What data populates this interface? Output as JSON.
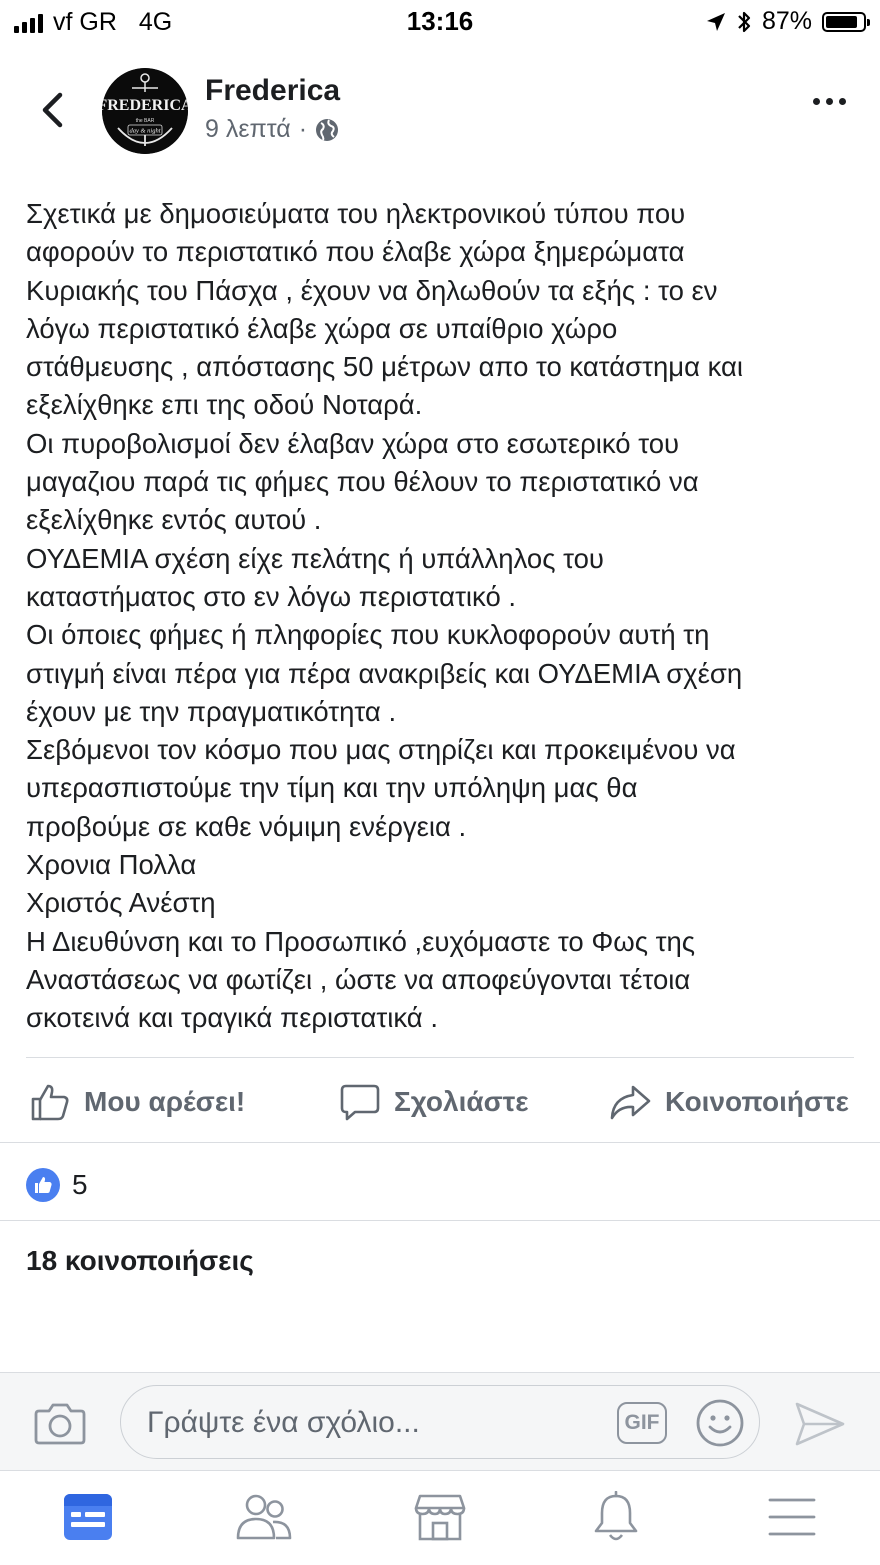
{
  "status_bar": {
    "carrier": "vf GR",
    "network": "4G",
    "time": "13:16",
    "battery": "87%",
    "battery_level": 0.87
  },
  "header": {
    "page_name": "Frederica",
    "time_ago": "9 λεπτά",
    "separator": "·",
    "avatar": {
      "text": "FREDERICA",
      "small_1": "the BAR",
      "small_2": "day & night"
    },
    "icons": {
      "back": "chevron-left-icon",
      "audience": "globe-icon",
      "more": "more-dots-icon"
    }
  },
  "post": {
    "lines": [
      "Σχετικά με δημοσιεύματα του ηλεκτρονικού τύπου που",
      "αφορούν το περιστατικό που έλαβε χώρα ξημερώματα",
      "Κυριακής του Πάσχα , έχουν να δηλωθούν τα εξής : το εν",
      "λόγω περιστατικό έλαβε χώρα σε υπαίθριο χώρο",
      "στάθμευσης , απόστασης 50 μέτρων απο το κατάστημα και",
      "εξελίχθηκε επι της οδού Νοταρά.",
      "Οι πυροβολισμοί δεν έλαβαν χώρα στο εσωτερικό του",
      "μαγαζιου παρά τις φήμες που θέλουν το περιστατικό να",
      "εξελίχθηκε εντός αυτού .",
      "ΟΥΔΕΜΙΑ σχέση είχε πελάτης ή υπάλληλος του",
      "καταστήματος στο εν λόγω περιστατικό .",
      "Οι όποιες φήμες ή πληφορίες που κυκλοφορούν αυτή τη",
      "στιγμή είναι πέρα για πέρα ανακριβείς και ΟΥΔΕΜΙΑ σχέση",
      "έχουν με την πραγματικότητα .",
      "Σεβόμενοι τον κόσμο που μας στηρίζει και προκειμένου να",
      "υπερασπιστούμε την τίμη και την υπόληψη μας θα",
      "προβούμε σε καθε νόμιμη ενέργεια .",
      "Χρονια Πολλα",
      "Χριστός Ανέστη",
      "Η Διευθύνση και το Προσωπικό  ,ευχόμαστε το Φως της",
      "Αναστάσεως να φωτίζει , ώστε να αποφεύγονται τέτοια",
      "σκοτεινά και τραγικά περιστατικά ."
    ]
  },
  "actions": {
    "like": "Μου αρέσει!",
    "comment": "Σχολιάστε",
    "share": "Κοινοποιήστε"
  },
  "reactions": {
    "count": "5"
  },
  "shares": {
    "label": "18 κοινοποιήσεις"
  },
  "comment_bar": {
    "placeholder": "Γράψτε ένα σχόλιο...",
    "gif_label": "GIF",
    "icons": {
      "camera": "camera-icon",
      "emoji": "emoji-icon",
      "send": "send-icon"
    }
  },
  "tab_bar": {
    "tabs": [
      "news-feed-icon",
      "friends-icon",
      "marketplace-icon",
      "notifications-icon",
      "menu-icon"
    ],
    "active_color": "#4a7ff0"
  },
  "colors": {
    "text": "#1c1e21",
    "secondary": "#606770",
    "accent": "#4a7ff0",
    "divider": "#dadde1"
  }
}
